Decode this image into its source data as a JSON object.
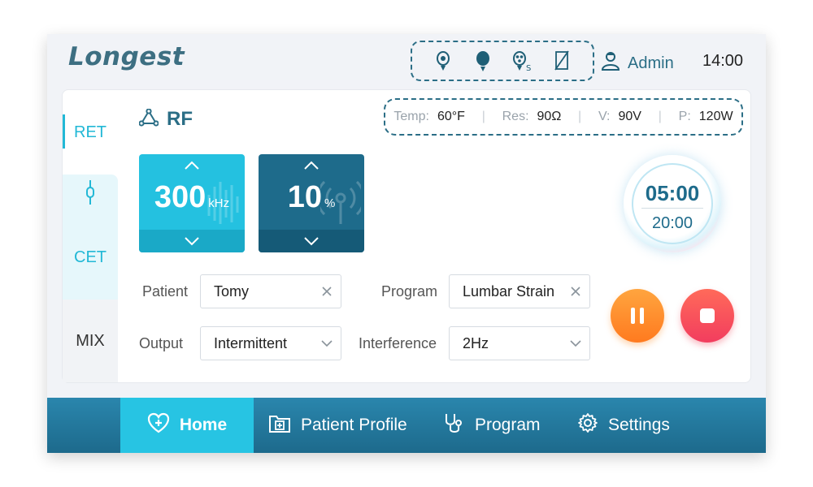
{
  "header": {
    "logo": "Longest",
    "status_icons": [
      "electrode-pad-icon",
      "electrode-solid-icon",
      "electrode-small-icon",
      "disconnected-icon"
    ],
    "status_icon_sub": "S",
    "user": "Admin",
    "time": "14:00"
  },
  "sidebar": {
    "tabs": [
      {
        "label": "RET"
      },
      {
        "label": ""
      },
      {
        "label": "CET"
      },
      {
        "label": "MIX"
      }
    ]
  },
  "mode": {
    "title": "RF"
  },
  "readouts": [
    {
      "label": "Temp",
      "value": "60°F"
    },
    {
      "label": "Res",
      "value": "90Ω"
    },
    {
      "label": "V",
      "value": "90V"
    },
    {
      "label": "P",
      "value": "120W"
    }
  ],
  "frequency": {
    "value": "300",
    "unit": "kHz"
  },
  "power": {
    "value": "10",
    "unit": "%"
  },
  "timer": {
    "elapsed": "05:00",
    "total": "20:00"
  },
  "form": {
    "patient_label": "Patient",
    "patient_value": "Tomy",
    "program_label": "Program",
    "program_value": "Lumbar Strain",
    "output_label": "Output",
    "output_value": "Intermittent",
    "interference_label": "Interference",
    "interference_value": "2Hz"
  },
  "nav": {
    "home": "Home",
    "profile": "Patient Profile",
    "program": "Program",
    "settings": "Settings"
  },
  "colors": {
    "accent": "#22b8d6",
    "brand": "#2b6e86",
    "pause": "#ff8a2a",
    "stop": "#f24a5e"
  }
}
